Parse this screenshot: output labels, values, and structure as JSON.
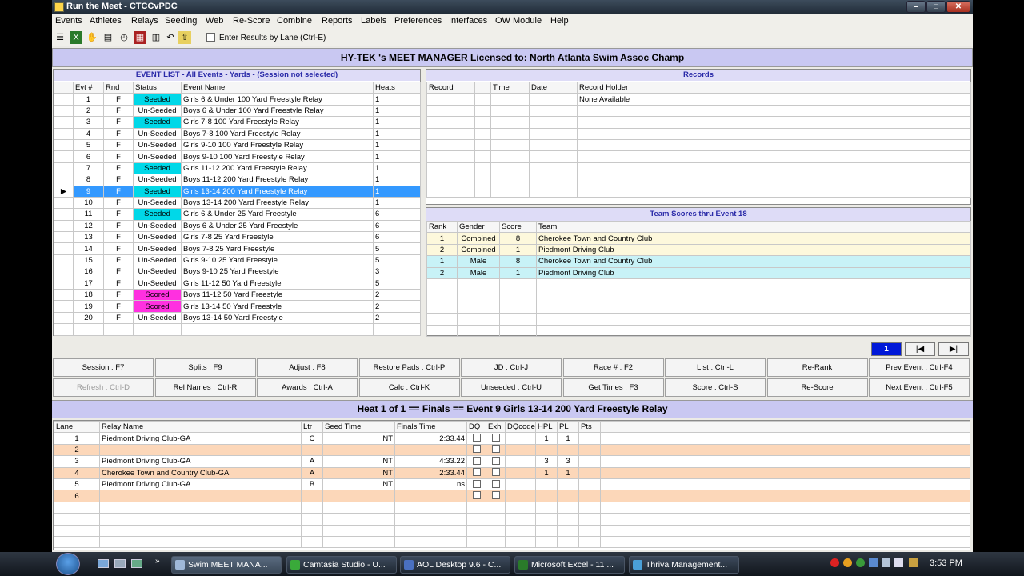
{
  "window": {
    "title": "Run the Meet - CTCCvPDC"
  },
  "menu": [
    "Events",
    "Athletes",
    "Relays",
    "Seeding",
    "Web",
    "Re-Score",
    "Combine",
    "Reports",
    "Labels",
    "Preferences",
    "Interfaces",
    "OW Module",
    "Help"
  ],
  "toolbar": {
    "enter_by_lane": "Enter Results by Lane (Ctrl-E)"
  },
  "license": "HY-TEK 's MEET MANAGER Licensed to:  North Atlanta Swim Assoc Champ",
  "event_list": {
    "title": "EVENT LIST - All Events - Yards - (Session not selected)",
    "headers": [
      "Evt #",
      "Rnd",
      "Status",
      "Event Name",
      "Heats"
    ],
    "rows": [
      [
        "1",
        "F",
        "Seeded",
        "Girls 6 & Under 100 Yard Freestyle Relay",
        "1"
      ],
      [
        "2",
        "F",
        "Un-Seeded",
        "Boys 6 & Under 100 Yard Freestyle Relay",
        "1"
      ],
      [
        "3",
        "F",
        "Seeded",
        "Girls 7-8 100 Yard Freestyle Relay",
        "1"
      ],
      [
        "4",
        "F",
        "Un-Seeded",
        "Boys 7-8 100 Yard Freestyle Relay",
        "1"
      ],
      [
        "5",
        "F",
        "Un-Seeded",
        "Girls 9-10 100 Yard Freestyle Relay",
        "1"
      ],
      [
        "6",
        "F",
        "Un-Seeded",
        "Boys 9-10 100 Yard Freestyle Relay",
        "1"
      ],
      [
        "7",
        "F",
        "Seeded",
        "Girls 11-12 200 Yard Freestyle Relay",
        "1"
      ],
      [
        "8",
        "F",
        "Un-Seeded",
        "Boys 11-12 200 Yard Freestyle Relay",
        "1"
      ],
      [
        "9",
        "F",
        "Seeded",
        "Girls 13-14 200 Yard Freestyle Relay",
        "1"
      ],
      [
        "10",
        "F",
        "Un-Seeded",
        "Boys 13-14 200 Yard Freestyle Relay",
        "1"
      ],
      [
        "11",
        "F",
        "Seeded",
        "Girls 6 & Under 25 Yard Freestyle",
        "6"
      ],
      [
        "12",
        "F",
        "Un-Seeded",
        "Boys 6 & Under 25 Yard Freestyle",
        "6"
      ],
      [
        "13",
        "F",
        "Un-Seeded",
        "Girls 7-8 25 Yard Freestyle",
        "6"
      ],
      [
        "14",
        "F",
        "Un-Seeded",
        "Boys 7-8 25 Yard Freestyle",
        "5"
      ],
      [
        "15",
        "F",
        "Un-Seeded",
        "Girls 9-10 25 Yard Freestyle",
        "5"
      ],
      [
        "16",
        "F",
        "Un-Seeded",
        "Boys 9-10 25 Yard Freestyle",
        "3"
      ],
      [
        "17",
        "F",
        "Un-Seeded",
        "Girls 11-12 50 Yard Freestyle",
        "5"
      ],
      [
        "18",
        "F",
        "Scored",
        "Boys 11-12 50 Yard Freestyle",
        "2"
      ],
      [
        "19",
        "F",
        "Scored",
        "Girls 13-14 50 Yard Freestyle",
        "2"
      ],
      [
        "20",
        "F",
        "Un-Seeded",
        "Boys 13-14 50 Yard Freestyle",
        "2"
      ]
    ],
    "selected_index": 8
  },
  "records": {
    "title": "Records",
    "headers": [
      "Record",
      "",
      "Time",
      "Date",
      "Record Holder"
    ],
    "holder": "None Available"
  },
  "team_scores": {
    "title": "Team Scores thru Event 18",
    "headers": [
      "Rank",
      "Gender",
      "Score",
      "Team"
    ],
    "rows": [
      [
        "1",
        "Combined",
        "8",
        "Cherokee Town and Country Club"
      ],
      [
        "2",
        "Combined",
        "1",
        "Piedmont Driving Club"
      ],
      [
        "1",
        "Male",
        "8",
        "Cherokee Town and Country Club"
      ],
      [
        "2",
        "Male",
        "1",
        "Piedmont Driving Club"
      ]
    ]
  },
  "pager": {
    "current": "1"
  },
  "buttons_row1": [
    "Session : F7",
    "Splits : F9",
    "Adjust : F8",
    "Restore Pads : Ctrl-P",
    "JD : Ctrl-J",
    "Race # : F2",
    "List : Ctrl-L",
    "Re-Rank",
    "Prev Event : Ctrl-F4"
  ],
  "buttons_row2": [
    "Refresh : Ctrl-D",
    "Rel Names : Ctrl-R",
    "Awards : Ctrl-A",
    "Calc : Ctrl-K",
    "Unseeded : Ctrl-U",
    "Get Times : F3",
    "Score : Ctrl-S",
    "Re-Score",
    "Next Event : Ctrl-F5"
  ],
  "heat": {
    "title": "Heat  1  of  1  ==  Finals  ==  Event 9  Girls 13-14 200 Yard Freestyle Relay",
    "headers": [
      "Lane",
      "Relay Name",
      "Ltr",
      "Seed Time",
      "Finals Time",
      "DQ",
      "Exh",
      "DQcode",
      "HPL",
      "PL",
      "Pts"
    ],
    "rows": [
      [
        "1",
        "Piedmont Driving Club-GA",
        "C",
        "NT",
        "2:33.44",
        "",
        "",
        "",
        "1",
        "1",
        ""
      ],
      [
        "2",
        "",
        "",
        "",
        "",
        "",
        "",
        "",
        "",
        "",
        ""
      ],
      [
        "3",
        "Piedmont Driving Club-GA",
        "A",
        "NT",
        "4:33.22",
        "",
        "",
        "",
        "3",
        "3",
        ""
      ],
      [
        "4",
        "Cherokee Town and Country Club-GA",
        "A",
        "NT",
        "2:33.44",
        "",
        "",
        "",
        "1",
        "1",
        ""
      ],
      [
        "5",
        "Piedmont Driving Club-GA",
        "B",
        "NT",
        "ns",
        "",
        "",
        "",
        "",
        "",
        ""
      ],
      [
        "6",
        "",
        "",
        "",
        "",
        "",
        "",
        "",
        "",
        "",
        ""
      ]
    ]
  },
  "taskbar": {
    "items": [
      "Swim MEET MANA...",
      "Camtasia Studio - U...",
      "AOL Desktop 9.6 - C...",
      "Microsoft Excel - 11 ...",
      "Thriva Management..."
    ],
    "clock": "3:53 PM"
  },
  "colors": {
    "seeded": "#00d8e8",
    "scored": "#ff30e0",
    "header_lavender": "#c9c8f2",
    "selected": "#3399ff"
  }
}
